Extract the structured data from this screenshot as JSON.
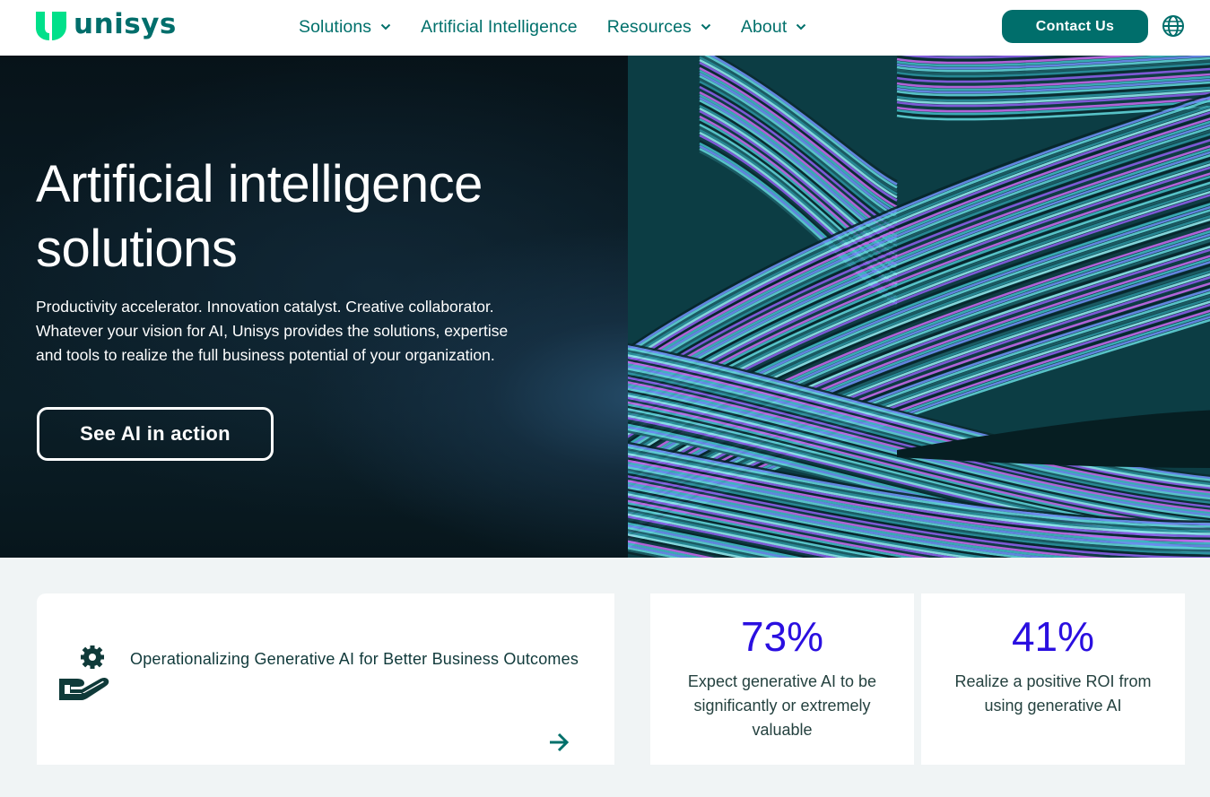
{
  "header": {
    "logo_text": "unisys",
    "nav": [
      {
        "label": "Solutions",
        "has_dropdown": true
      },
      {
        "label": "Artificial Intelligence",
        "has_dropdown": false
      },
      {
        "label": "Resources",
        "has_dropdown": true
      },
      {
        "label": "About",
        "has_dropdown": true
      }
    ],
    "contact_label": "Contact Us",
    "globe_icon": "globe-icon"
  },
  "hero": {
    "title_line1": "Artificial intelligence",
    "title_line2": "solutions",
    "description": "Productivity accelerator. Innovation catalyst. Creative collaborator. Whatever your vision for AI, Unisys provides the solutions, expertise and tools to realize the full business potential of your organization.",
    "cta_label": "See AI in action",
    "image": "abstract-fiber-strands-image"
  },
  "cards": {
    "feature": {
      "icon": "gear-hand-icon",
      "title": "Operationalizing Generative AI for Better Business Outcomes",
      "arrow_icon": "arrow-right-icon"
    },
    "stats": [
      {
        "value": "73%",
        "label": "Expect generative AI to be significantly or extremely valuable"
      },
      {
        "value": "41%",
        "label": "Realize a positive ROI from using generative AI"
      }
    ]
  },
  "colors": {
    "brand_teal": "#006e6b",
    "logo_green": "#00e08a",
    "stat_blue": "#2a0fe0",
    "page_bg": "#f0f4f5"
  }
}
